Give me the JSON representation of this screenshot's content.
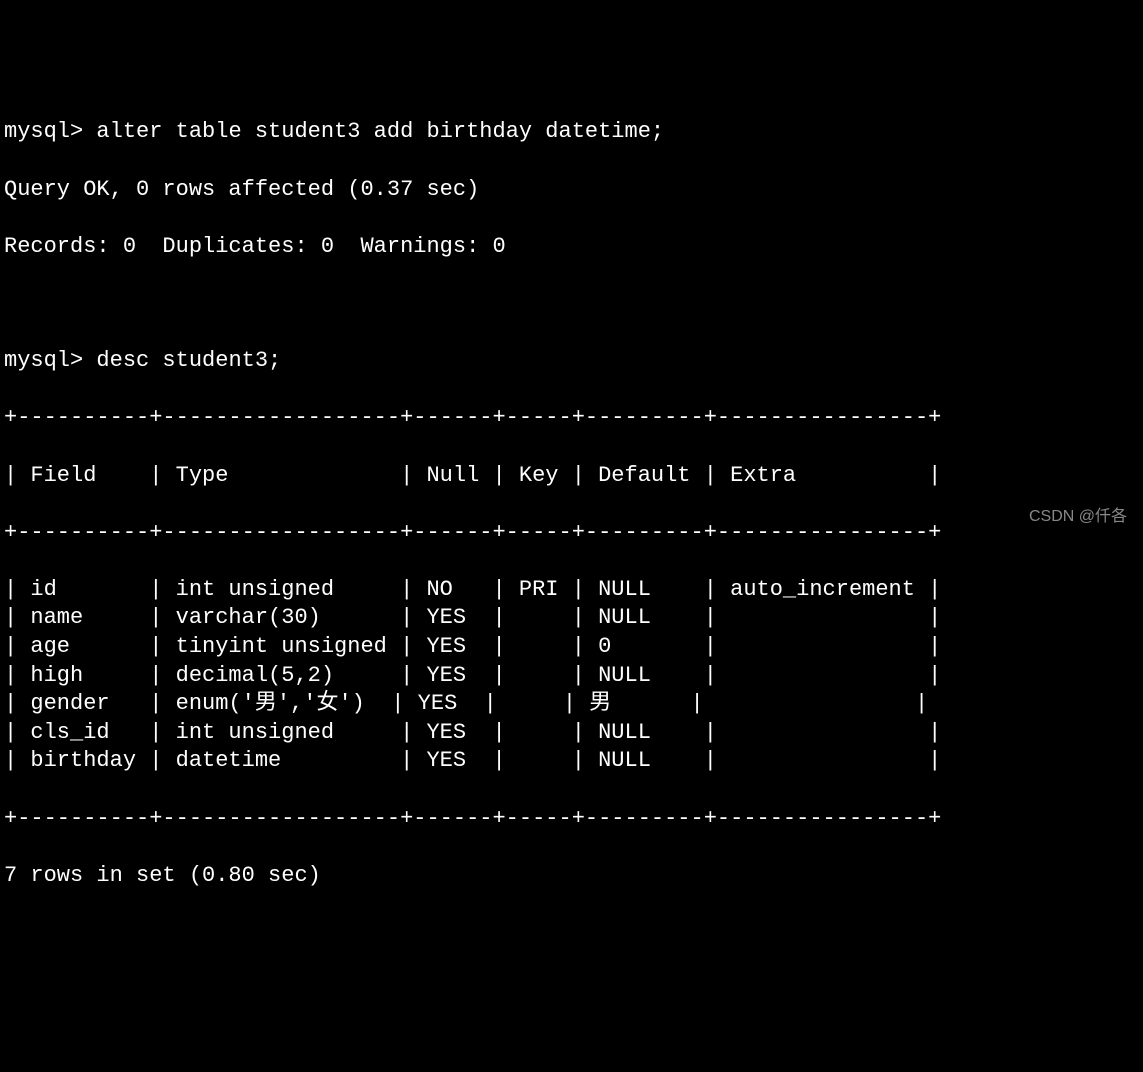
{
  "prompt": "mysql>",
  "cmd1": "alter table student3 add birthday datetime;",
  "result1_line1": "Query OK, 0 rows affected (0.37 sec)",
  "result1_line2": "Records: 0  Duplicates: 0  Warnings: 0",
  "cmd2": "desc student3;",
  "table_border": "+----------+------------------+------+-----+---------+----------------+",
  "headers": {
    "field": "Field",
    "type": "Type",
    "null": "Null",
    "key": "Key",
    "default": "Default",
    "extra": "Extra"
  },
  "rows": [
    {
      "field": "id",
      "type": "int unsigned",
      "null": "NO",
      "key": "PRI",
      "default": "NULL",
      "extra": "auto_increment"
    },
    {
      "field": "name",
      "type": "varchar(30)",
      "null": "YES",
      "key": "",
      "default": "NULL",
      "extra": ""
    },
    {
      "field": "age",
      "type": "tinyint unsigned",
      "null": "YES",
      "key": "",
      "default": "0",
      "extra": ""
    },
    {
      "field": "high",
      "type": "decimal(5,2)",
      "null": "YES",
      "key": "",
      "default": "NULL",
      "extra": ""
    },
    {
      "field": "gender",
      "type": "enum('男','女')",
      "null": "YES",
      "key": "",
      "default": "男",
      "extra": ""
    },
    {
      "field": "cls_id",
      "type": "int unsigned",
      "null": "YES",
      "key": "",
      "default": "NULL",
      "extra": ""
    },
    {
      "field": "birthday",
      "type": "datetime",
      "null": "YES",
      "key": "",
      "default": "NULL",
      "extra": ""
    }
  ],
  "footer": "7 rows in set (0.80 sec)",
  "watermark": "CSDN @仟各",
  "chart_data": {
    "type": "table",
    "title": "desc student3",
    "columns": [
      "Field",
      "Type",
      "Null",
      "Key",
      "Default",
      "Extra"
    ],
    "data": [
      [
        "id",
        "int unsigned",
        "NO",
        "PRI",
        "NULL",
        "auto_increment"
      ],
      [
        "name",
        "varchar(30)",
        "YES",
        "",
        "NULL",
        ""
      ],
      [
        "age",
        "tinyint unsigned",
        "YES",
        "",
        "0",
        ""
      ],
      [
        "high",
        "decimal(5,2)",
        "YES",
        "",
        "NULL",
        ""
      ],
      [
        "gender",
        "enum('男','女')",
        "YES",
        "",
        "男",
        ""
      ],
      [
        "cls_id",
        "int unsigned",
        "YES",
        "",
        "NULL",
        ""
      ],
      [
        "birthday",
        "datetime",
        "YES",
        "",
        "NULL",
        ""
      ]
    ]
  }
}
